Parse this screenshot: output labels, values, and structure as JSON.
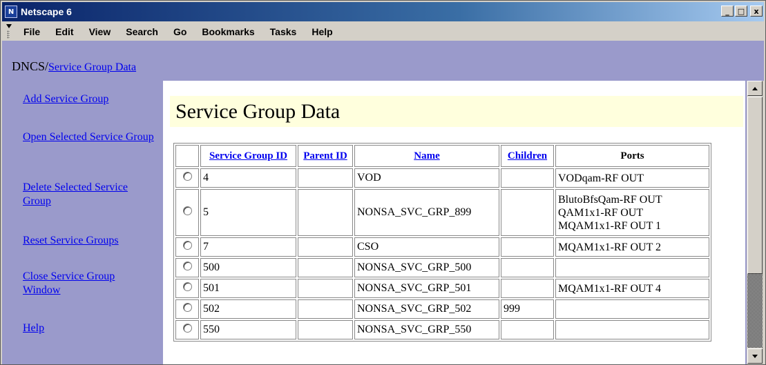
{
  "window": {
    "title": "Netscape 6",
    "app_icon_glyph": "N"
  },
  "window_buttons": {
    "minimize": "_",
    "maximize": "□",
    "close": "x"
  },
  "menu": [
    "File",
    "Edit",
    "View",
    "Search",
    "Go",
    "Bookmarks",
    "Tasks",
    "Help"
  ],
  "breadcrumb": {
    "root": "DNCS",
    "separator": "/",
    "link": "Service Group Data"
  },
  "nav": [
    "Add Service Group",
    "Open Selected Service Group",
    "Delete Selected Service Group",
    "Reset Service Groups",
    "Close Service Group Window",
    "Help"
  ],
  "page_title": "Service Group Data",
  "table": {
    "headers": [
      "Service Group ID",
      "Parent ID",
      "Name",
      "Children",
      "Ports"
    ],
    "rows": [
      {
        "id": "4",
        "parent": "",
        "name": "VOD",
        "children": "",
        "ports": [
          "VODqam-RF OUT"
        ]
      },
      {
        "id": "5",
        "parent": "",
        "name": "NONSA_SVC_GRP_899",
        "children": "",
        "ports": [
          "BlutoBfsQam-RF OUT",
          "QAM1x1-RF OUT",
          "MQAM1x1-RF OUT 1"
        ]
      },
      {
        "id": "7",
        "parent": "",
        "name": "CSO",
        "children": "",
        "ports": [
          "MQAM1x1-RF OUT 2"
        ]
      },
      {
        "id": "500",
        "parent": "",
        "name": "NONSA_SVC_GRP_500",
        "children": "",
        "ports": []
      },
      {
        "id": "501",
        "parent": "",
        "name": "NONSA_SVC_GRP_501",
        "children": "",
        "ports": [
          "MQAM1x1-RF OUT 4"
        ]
      },
      {
        "id": "502",
        "parent": "",
        "name": "NONSA_SVC_GRP_502",
        "children": "999",
        "ports": []
      },
      {
        "id": "550",
        "parent": "",
        "name": "NONSA_SVC_GRP_550",
        "children": "",
        "ports": []
      }
    ]
  },
  "colors": {
    "content_bg": "#9a9acb",
    "title_bg": "#ffffdd",
    "link": "#0000ee"
  }
}
